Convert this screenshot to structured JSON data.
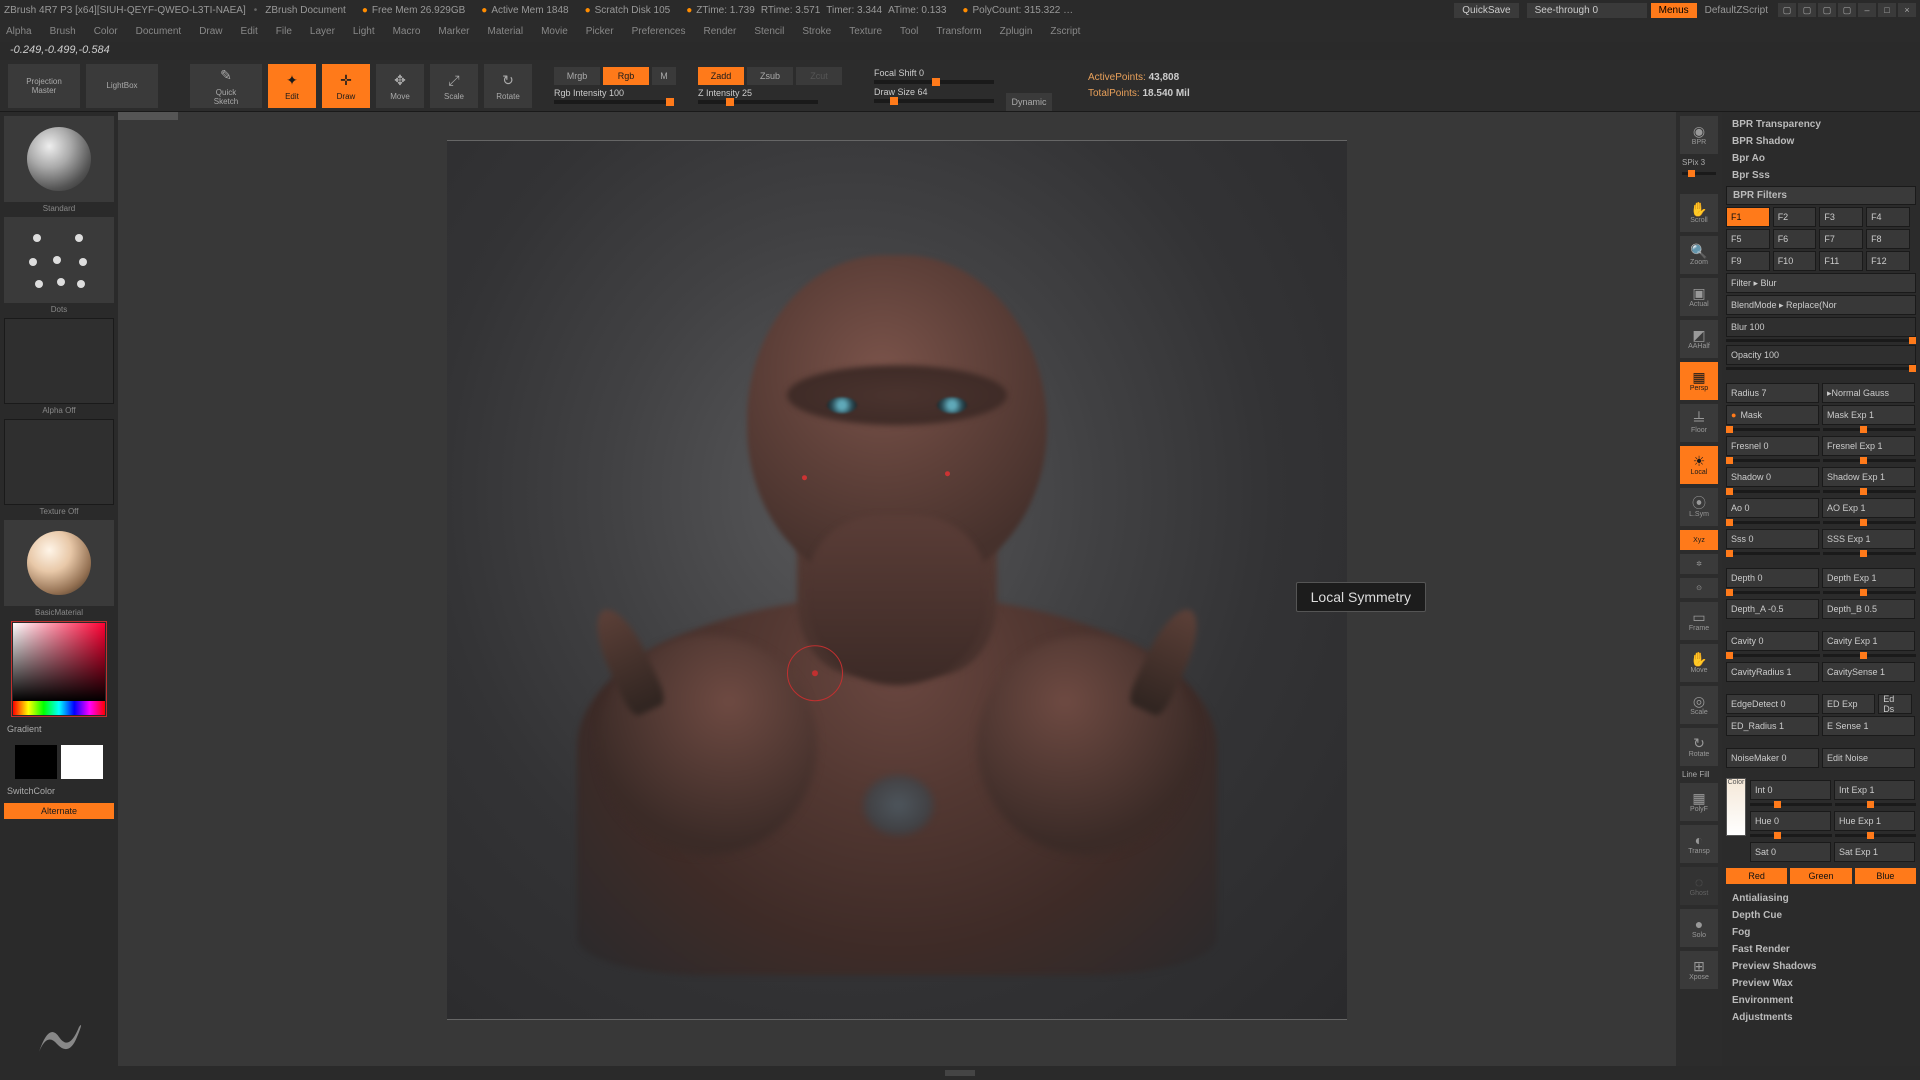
{
  "title": {
    "app": "ZBrush 4R7 P3 [x64][SIUH-QEYF-QWEO-L3TI-NAEA]",
    "doc": "ZBrush Document",
    "mem": "Free Mem  26.929GB",
    "amem": "Active Mem 1848",
    "scratch": "Scratch Disk 105",
    "ztime": "ZTime: 1.739",
    "rtime": "RTime: 3.571",
    "timer": "Timer: 3.344",
    "atime": "ATime: 0.133",
    "poly": "PolyCount: 315.322 …",
    "quicksave": "QuickSave",
    "seethrough": "See-through  0",
    "menus": "Menus",
    "script": "DefaultZScript"
  },
  "menus": [
    "Alpha",
    "Brush",
    "Color",
    "Document",
    "Draw",
    "Edit",
    "File",
    "Layer",
    "Light",
    "Macro",
    "Marker",
    "Material",
    "Movie",
    "Picker",
    "Preferences",
    "Render",
    "Stencil",
    "Stroke",
    "Texture",
    "Tool",
    "Transform",
    "Zplugin",
    "Zscript"
  ],
  "status": "-0.249,-0.499,-0.584",
  "toolbar": {
    "projection": "Projection\nMaster",
    "lightbox": "LightBox",
    "quicksketch": "Quick\nSketch",
    "edit": "Edit",
    "draw": "Draw",
    "move": "Move",
    "scale": "Scale",
    "rotate": "Rotate",
    "mrgb": "Mrgb",
    "rgb": "Rgb",
    "m": "M",
    "rgb_intensity": "Rgb Intensity 100",
    "zadd": "Zadd",
    "zsub": "Zsub",
    "zcut": "Zcut",
    "z_intensity": "Z Intensity 25",
    "focal": "Focal Shift 0",
    "drawsize": "Draw Size 64",
    "dynamic": "Dynamic",
    "active": "ActivePoints:",
    "active_v": "43,808",
    "total": "TotalPoints:",
    "total_v": "18.540 Mil"
  },
  "left": {
    "brush": "Standard",
    "stroke": "Dots",
    "alpha": "Alpha  Off",
    "texture": "Texture  Off",
    "material": "BasicMaterial",
    "gradient": "Gradient",
    "switch": "SwitchColor",
    "alternate": "Alternate"
  },
  "tooltip": "Local Symmetry",
  "iconstrip": {
    "bpr": "BPR",
    "spix": "SPix 3",
    "scroll": "Scroll",
    "zoom": "Zoom",
    "actual": "Actual",
    "aahalf": "AAHalf",
    "persp": "Persp",
    "floor": "Floor",
    "local": "Local",
    "lsym": "L.Sym",
    "xyz": "Xyz",
    "frame": "Frame",
    "move": "Move",
    "scale": "Scale",
    "rotate": "Rotate",
    "linefill": "Line Fill",
    "polyf": "PolyF",
    "transp": "Transp",
    "ghost": "Ghost",
    "solo": "Solo",
    "xpose": "Xpose"
  },
  "props": {
    "headers": {
      "transparency": "BPR Transparency",
      "shadow": "BPR Shadow",
      "ao": "Bpr Ao",
      "sss": "Bpr Sss",
      "filters": "BPR Filters",
      "antialias": "Antialiasing",
      "depthcue": "Depth Cue",
      "fog": "Fog",
      "fast": "Fast Render",
      "pshadow": "Preview Shadows",
      "pwax": "Preview Wax",
      "env": "Environment",
      "adj": "Adjustments"
    },
    "fbuttons": [
      "F1",
      "F2",
      "F3",
      "F4",
      "F5",
      "F6",
      "F7",
      "F8",
      "F9",
      "F10",
      "F11",
      "F12"
    ],
    "filter": "Filter ▸ Blur",
    "blend": "BlendMode ▸ Replace(Nor",
    "blur": "Blur 100",
    "opacity": "Opacity 100",
    "radius": "Radius 7",
    "normal": "▸Normal  Gauss",
    "mask": "Mask",
    "mask_exp": "Mask  Exp 1",
    "fresnel": "Fresnel 0",
    "fresnel_exp": "Fresnel  Exp 1",
    "shadow": "Shadow 0",
    "shadow_exp": "Shadow  Exp 1",
    "ao": "Ao 0",
    "ao_exp": "AO  Exp 1",
    "sss": "Sss 0",
    "sss_exp": "SSS  Exp 1",
    "depth": "Depth 0",
    "depth_exp": "Depth  Exp 1",
    "deptha": "Depth_A -0.5",
    "depthb": "Depth_B 0.5",
    "cavity": "Cavity 0",
    "cavity_exp": "Cavity  Exp 1",
    "cavrad": "CavityRadius 1",
    "cavsense": "CavitySense 1",
    "edged": "EdgeDetect 0",
    "ed_exp": "ED  Exp",
    "ed_ds": "Ed Ds",
    "ed_rad": "ED_Radius 1",
    "e_sense": "E Sense 1",
    "noise": "NoiseMaker 0",
    "editnoise": "Edit Noise",
    "int": "Int 0",
    "int_exp": "Int  Exp 1",
    "hue": "Hue 0",
    "hue_exp": "Hue  Exp 1",
    "sat": "Sat 0",
    "sat_exp": "Sat  Exp 1",
    "color": "Color",
    "red": "Red",
    "green": "Green",
    "blue": "Blue"
  }
}
